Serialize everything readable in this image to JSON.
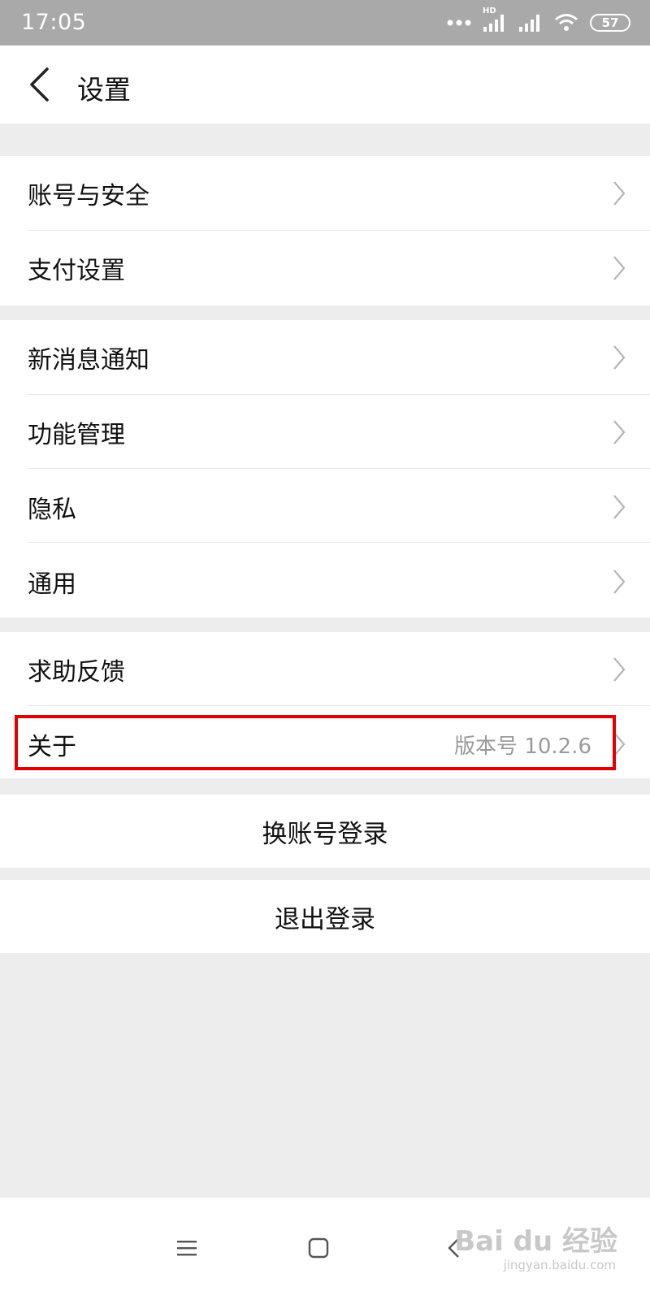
{
  "status_bar": {
    "time": "17:05",
    "network_label": "HD",
    "battery": "57",
    "icons": [
      "dots-icon",
      "signal-icon",
      "signal-icon",
      "wifi-icon",
      "battery-icon"
    ]
  },
  "header": {
    "back_icon": "chevron-left-icon",
    "title": "设置"
  },
  "groups": [
    {
      "items": [
        {
          "label": "账号与安全"
        },
        {
          "label": "支付设置"
        }
      ]
    },
    {
      "items": [
        {
          "label": "新消息通知"
        },
        {
          "label": "功能管理"
        },
        {
          "label": "隐私"
        },
        {
          "label": "通用"
        }
      ]
    },
    {
      "items": [
        {
          "label": "求助反馈"
        },
        {
          "label": "关于",
          "value": "版本号 10.2.6"
        }
      ]
    }
  ],
  "actions": {
    "switch_account": "换账号登录",
    "logout": "退出登录"
  },
  "system_nav": {
    "icons": [
      "menu-icon",
      "home-icon",
      "back-icon"
    ]
  },
  "watermark": {
    "text": "Bai du 经验",
    "sub": "jingyan.baidu.com"
  },
  "colors": {
    "highlight": "#e10000",
    "background": "#ededed",
    "status_bar": "#a9a9a9"
  }
}
